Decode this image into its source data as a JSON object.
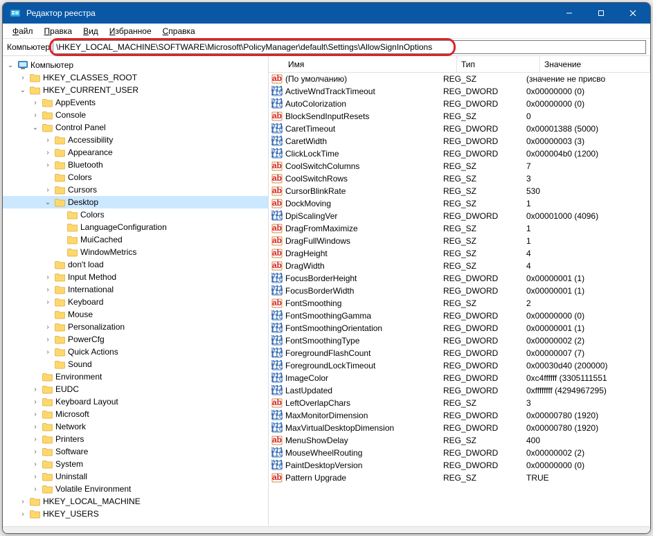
{
  "titlebar": {
    "title": "Редактор реестра"
  },
  "menubar": {
    "items": [
      "Файл",
      "Правка",
      "Вид",
      "Избранное",
      "Справка"
    ]
  },
  "address": {
    "label": "Компьютер",
    "path": "\\HKEY_LOCAL_MACHINE\\SOFTWARE\\Microsoft\\PolicyManager\\default\\Settings\\AllowSignInOptions"
  },
  "columns": {
    "name": "Имя",
    "type": "Тип",
    "value": "Значение"
  },
  "tree": [
    {
      "label": "Компьютер",
      "icon": "computer",
      "depth": 0,
      "exp": "open",
      "sel": false
    },
    {
      "label": "HKEY_CLASSES_ROOT",
      "icon": "folder",
      "depth": 1,
      "exp": "closed"
    },
    {
      "label": "HKEY_CURRENT_USER",
      "icon": "folder",
      "depth": 1,
      "exp": "open"
    },
    {
      "label": "AppEvents",
      "icon": "folder",
      "depth": 2,
      "exp": "closed"
    },
    {
      "label": "Console",
      "icon": "folder",
      "depth": 2,
      "exp": "closed"
    },
    {
      "label": "Control Panel",
      "icon": "folder",
      "depth": 2,
      "exp": "open"
    },
    {
      "label": "Accessibility",
      "icon": "folder",
      "depth": 3,
      "exp": "closed"
    },
    {
      "label": "Appearance",
      "icon": "folder",
      "depth": 3,
      "exp": "closed"
    },
    {
      "label": "Bluetooth",
      "icon": "folder",
      "depth": 3,
      "exp": "closed"
    },
    {
      "label": "Colors",
      "icon": "folder",
      "depth": 3,
      "exp": "none"
    },
    {
      "label": "Cursors",
      "icon": "folder",
      "depth": 3,
      "exp": "closed"
    },
    {
      "label": "Desktop",
      "icon": "folder",
      "depth": 3,
      "exp": "open",
      "sel": true
    },
    {
      "label": "Colors",
      "icon": "folder",
      "depth": 4,
      "exp": "none"
    },
    {
      "label": "LanguageConfiguration",
      "icon": "folder",
      "depth": 4,
      "exp": "none"
    },
    {
      "label": "MuiCached",
      "icon": "folder",
      "depth": 4,
      "exp": "none"
    },
    {
      "label": "WindowMetrics",
      "icon": "folder",
      "depth": 4,
      "exp": "none"
    },
    {
      "label": "don't load",
      "icon": "folder",
      "depth": 3,
      "exp": "none"
    },
    {
      "label": "Input Method",
      "icon": "folder",
      "depth": 3,
      "exp": "closed"
    },
    {
      "label": "International",
      "icon": "folder",
      "depth": 3,
      "exp": "closed"
    },
    {
      "label": "Keyboard",
      "icon": "folder",
      "depth": 3,
      "exp": "closed"
    },
    {
      "label": "Mouse",
      "icon": "folder",
      "depth": 3,
      "exp": "none"
    },
    {
      "label": "Personalization",
      "icon": "folder",
      "depth": 3,
      "exp": "closed"
    },
    {
      "label": "PowerCfg",
      "icon": "folder",
      "depth": 3,
      "exp": "closed"
    },
    {
      "label": "Quick Actions",
      "icon": "folder",
      "depth": 3,
      "exp": "closed"
    },
    {
      "label": "Sound",
      "icon": "folder",
      "depth": 3,
      "exp": "none"
    },
    {
      "label": "Environment",
      "icon": "folder",
      "depth": 2,
      "exp": "none"
    },
    {
      "label": "EUDC",
      "icon": "folder",
      "depth": 2,
      "exp": "closed"
    },
    {
      "label": "Keyboard Layout",
      "icon": "folder",
      "depth": 2,
      "exp": "closed"
    },
    {
      "label": "Microsoft",
      "icon": "folder",
      "depth": 2,
      "exp": "closed"
    },
    {
      "label": "Network",
      "icon": "folder",
      "depth": 2,
      "exp": "closed"
    },
    {
      "label": "Printers",
      "icon": "folder",
      "depth": 2,
      "exp": "closed"
    },
    {
      "label": "Software",
      "icon": "folder",
      "depth": 2,
      "exp": "closed"
    },
    {
      "label": "System",
      "icon": "folder",
      "depth": 2,
      "exp": "closed"
    },
    {
      "label": "Uninstall",
      "icon": "folder",
      "depth": 2,
      "exp": "closed"
    },
    {
      "label": "Volatile Environment",
      "icon": "folder",
      "depth": 2,
      "exp": "closed"
    },
    {
      "label": "HKEY_LOCAL_MACHINE",
      "icon": "folder",
      "depth": 1,
      "exp": "closed"
    },
    {
      "label": "HKEY_USERS",
      "icon": "folder",
      "depth": 1,
      "exp": "closed"
    }
  ],
  "values": [
    {
      "name": "(По умолчанию)",
      "type": "REG_SZ",
      "val": "(значение не присво",
      "kind": "sz"
    },
    {
      "name": "ActiveWndTrackTimeout",
      "type": "REG_DWORD",
      "val": "0x00000000 (0)",
      "kind": "dw"
    },
    {
      "name": "AutoColorization",
      "type": "REG_DWORD",
      "val": "0x00000000 (0)",
      "kind": "dw"
    },
    {
      "name": "BlockSendInputResets",
      "type": "REG_SZ",
      "val": "0",
      "kind": "sz"
    },
    {
      "name": "CaretTimeout",
      "type": "REG_DWORD",
      "val": "0x00001388 (5000)",
      "kind": "dw"
    },
    {
      "name": "CaretWidth",
      "type": "REG_DWORD",
      "val": "0x00000003 (3)",
      "kind": "dw"
    },
    {
      "name": "ClickLockTime",
      "type": "REG_DWORD",
      "val": "0x000004b0 (1200)",
      "kind": "dw"
    },
    {
      "name": "CoolSwitchColumns",
      "type": "REG_SZ",
      "val": "7",
      "kind": "sz"
    },
    {
      "name": "CoolSwitchRows",
      "type": "REG_SZ",
      "val": "3",
      "kind": "sz"
    },
    {
      "name": "CursorBlinkRate",
      "type": "REG_SZ",
      "val": "530",
      "kind": "sz"
    },
    {
      "name": "DockMoving",
      "type": "REG_SZ",
      "val": "1",
      "kind": "sz"
    },
    {
      "name": "DpiScalingVer",
      "type": "REG_DWORD",
      "val": "0x00001000 (4096)",
      "kind": "dw"
    },
    {
      "name": "DragFromMaximize",
      "type": "REG_SZ",
      "val": "1",
      "kind": "sz"
    },
    {
      "name": "DragFullWindows",
      "type": "REG_SZ",
      "val": "1",
      "kind": "sz"
    },
    {
      "name": "DragHeight",
      "type": "REG_SZ",
      "val": "4",
      "kind": "sz"
    },
    {
      "name": "DragWidth",
      "type": "REG_SZ",
      "val": "4",
      "kind": "sz"
    },
    {
      "name": "FocusBorderHeight",
      "type": "REG_DWORD",
      "val": "0x00000001 (1)",
      "kind": "dw"
    },
    {
      "name": "FocusBorderWidth",
      "type": "REG_DWORD",
      "val": "0x00000001 (1)",
      "kind": "dw"
    },
    {
      "name": "FontSmoothing",
      "type": "REG_SZ",
      "val": "2",
      "kind": "sz"
    },
    {
      "name": "FontSmoothingGamma",
      "type": "REG_DWORD",
      "val": "0x00000000 (0)",
      "kind": "dw"
    },
    {
      "name": "FontSmoothingOrientation",
      "type": "REG_DWORD",
      "val": "0x00000001 (1)",
      "kind": "dw"
    },
    {
      "name": "FontSmoothingType",
      "type": "REG_DWORD",
      "val": "0x00000002 (2)",
      "kind": "dw"
    },
    {
      "name": "ForegroundFlashCount",
      "type": "REG_DWORD",
      "val": "0x00000007 (7)",
      "kind": "dw"
    },
    {
      "name": "ForegroundLockTimeout",
      "type": "REG_DWORD",
      "val": "0x00030d40 (200000)",
      "kind": "dw"
    },
    {
      "name": "ImageColor",
      "type": "REG_DWORD",
      "val": "0xc4ffffff (3305111551",
      "kind": "dw"
    },
    {
      "name": "LastUpdated",
      "type": "REG_DWORD",
      "val": "0xffffffff (4294967295)",
      "kind": "dw"
    },
    {
      "name": "LeftOverlapChars",
      "type": "REG_SZ",
      "val": "3",
      "kind": "sz"
    },
    {
      "name": "MaxMonitorDimension",
      "type": "REG_DWORD",
      "val": "0x00000780 (1920)",
      "kind": "dw"
    },
    {
      "name": "MaxVirtualDesktopDimension",
      "type": "REG_DWORD",
      "val": "0x00000780 (1920)",
      "kind": "dw"
    },
    {
      "name": "MenuShowDelay",
      "type": "REG_SZ",
      "val": "400",
      "kind": "sz"
    },
    {
      "name": "MouseWheelRouting",
      "type": "REG_DWORD",
      "val": "0x00000002 (2)",
      "kind": "dw"
    },
    {
      "name": "PaintDesktopVersion",
      "type": "REG_DWORD",
      "val": "0x00000000 (0)",
      "kind": "dw"
    },
    {
      "name": "Pattern Upgrade",
      "type": "REG_SZ",
      "val": "TRUE",
      "kind": "sz"
    }
  ]
}
